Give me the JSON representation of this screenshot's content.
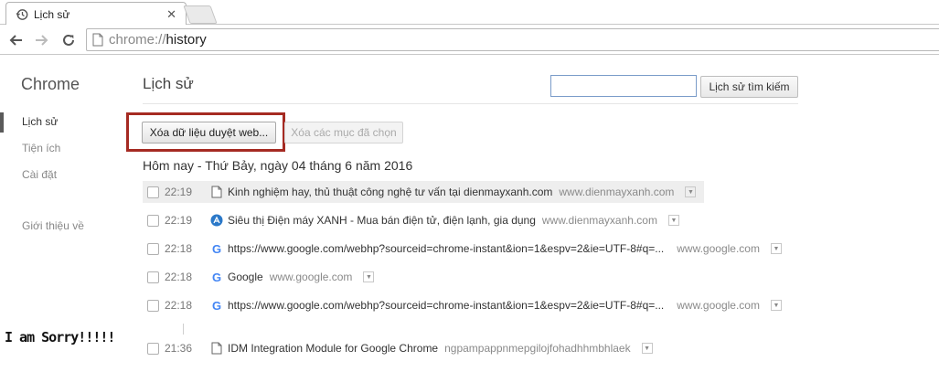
{
  "tab": {
    "title": "Lịch sử",
    "icon": "history-icon"
  },
  "toolbar": {
    "url_scheme": "chrome://",
    "url_path": "history"
  },
  "sidebar": {
    "brand": "Chrome",
    "items": [
      {
        "label": "Lịch sử",
        "active": true
      },
      {
        "label": "Tiện ích",
        "active": false
      },
      {
        "label": "Cài đặt",
        "active": false
      },
      {
        "label": "Giới thiệu về",
        "active": false
      }
    ]
  },
  "main": {
    "title": "Lịch sử",
    "search": {
      "value": "",
      "button_label": "Lịch sử tìm kiếm"
    },
    "clear_button_label": "Xóa dữ liệu duyệt web...",
    "remove_button_label": "Xóa các mục đã chọn",
    "day_heading": "Hôm nay - Thứ Bảy, ngày 04 tháng 6 năm 2016",
    "entries": [
      {
        "time": "22:19",
        "title": "Kinh nghiệm hay, thủ thuật công nghệ tư vấn tại dienmayxanh.com",
        "domain": "www.dienmayxanh.com",
        "favicon": "page-icon"
      },
      {
        "time": "22:19",
        "title": "Siêu thị Điện máy XANH - Mua bán điện tử, điện lạnh, gia dụng",
        "domain": "www.dienmayxanh.com",
        "favicon": "dienmayxanh-icon"
      },
      {
        "time": "22:18",
        "title": "https://www.google.com/webhp?sourceid=chrome-instant&ion=1&espv=2&ie=UTF-8#q=...",
        "domain": "www.google.com",
        "favicon": "google-icon"
      },
      {
        "time": "22:18",
        "title": "Google",
        "domain": "www.google.com",
        "favicon": "google-icon"
      },
      {
        "time": "22:18",
        "title": "https://www.google.com/webhp?sourceid=chrome-instant&ion=1&espv=2&ie=UTF-8#q=...",
        "domain": "www.google.com",
        "favicon": "google-icon"
      },
      {
        "time": "21:36",
        "title": "IDM Integration Module for Google Chrome",
        "domain": "ngpampappnmepgilojfohadhhmbhlaek",
        "favicon": "page-icon"
      }
    ]
  },
  "watermark": "I am Sorry!!!!!",
  "colors": {
    "highlight": "#a52a22",
    "search_border": "#7a9cc9"
  }
}
